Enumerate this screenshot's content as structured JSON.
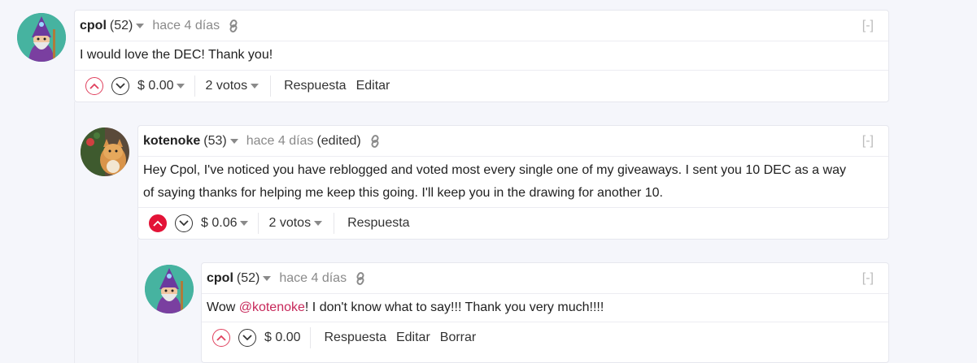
{
  "comments": [
    {
      "author": "cpol",
      "reputation": "(52)",
      "time": "hace 4 días",
      "edited": "",
      "collapse": "[-]",
      "body": "I would love the DEC! Thank you!",
      "upvoted": false,
      "payout": "$ 0.00",
      "votes": "2 votos",
      "actions": [
        "Respuesta",
        "Editar"
      ]
    },
    {
      "author": "kotenoke",
      "reputation": "(53)",
      "time": "hace 4 días",
      "edited": "(edited)",
      "collapse": "[-]",
      "body_line1": "Hey Cpol, I've noticed you have reblogged and voted most every single one of my giveaways. I sent you 10 DEC as a way",
      "body_line2": "of saying thanks for helping me keep this going. I'll keep you in the drawing for another 10.",
      "upvoted": true,
      "payout": "$ 0.06",
      "votes": "2 votos",
      "actions": [
        "Respuesta"
      ]
    },
    {
      "author": "cpol",
      "reputation": "(52)",
      "time": "hace 4 días",
      "edited": "",
      "collapse": "[-]",
      "body_before": "Wow ",
      "mention": "@kotenoke",
      "body_after": "! I don't know what to say!!! Thank you very much!!!!",
      "upvoted": false,
      "payout": "$ 0.00",
      "votes": "",
      "actions": [
        "Respuesta",
        "Editar",
        "Borrar"
      ]
    }
  ],
  "icons": {
    "upvote": "chevron-up-circle-icon",
    "downvote": "chevron-down-circle-icon",
    "link": "link-icon",
    "caret": "caret-down-icon"
  },
  "colors": {
    "accent": "#e31337",
    "mention": "#c7285a",
    "muted": "#8a8a8a",
    "background": "#f5f6fb"
  }
}
